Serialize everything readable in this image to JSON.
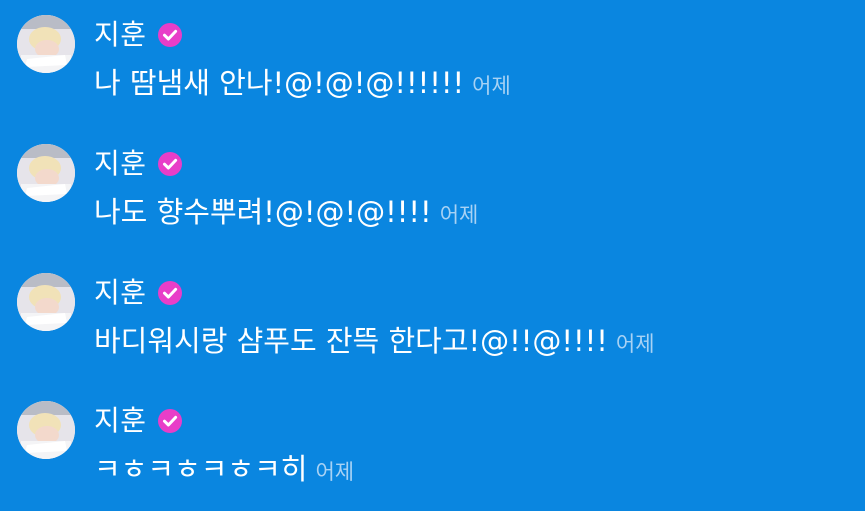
{
  "colors": {
    "background": "#0a86e0",
    "text": "#ffffff",
    "timestamp": "#a8d2f4",
    "verified_badge": "#e83ec8"
  },
  "messages": [
    {
      "sender": "지훈",
      "verified_icon": "verified-check-icon",
      "text": "나 땀냄새 안나!@!@!@!!!!!!",
      "time": "어제"
    },
    {
      "sender": "지훈",
      "verified_icon": "verified-check-icon",
      "text": "나도 향수뿌려!@!@!@!!!!",
      "time": "어제"
    },
    {
      "sender": "지훈",
      "verified_icon": "verified-check-icon",
      "text": "바디워시랑 샴푸도 잔뜩 한다고!@!!@!!!!",
      "time": "어제"
    },
    {
      "sender": "지훈",
      "verified_icon": "verified-check-icon",
      "text": "ㅋㅎㅋㅎㅋㅎㅋ히",
      "time": "어제"
    }
  ]
}
